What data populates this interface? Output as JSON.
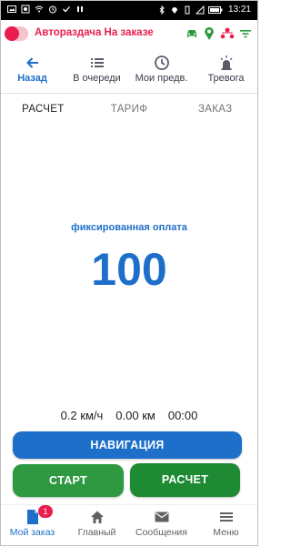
{
  "status_bar": {
    "time": "13:21"
  },
  "app": {
    "title": "Авторaздача На заказе",
    "accent": "#e91e4f"
  },
  "nav": {
    "items": [
      {
        "label": "Назад",
        "icon": "arrow-back-icon",
        "active": true
      },
      {
        "label": "В очереди",
        "icon": "list-icon"
      },
      {
        "label": "Мои предв.",
        "icon": "clock-icon"
      },
      {
        "label": "Тревога",
        "icon": "alarm-light-icon"
      }
    ]
  },
  "tabs": [
    {
      "label": "РАСЧЕТ",
      "active": true
    },
    {
      "label": "ТАРИФ"
    },
    {
      "label": "ЗАКАЗ"
    }
  ],
  "fare": {
    "label": "фиксированная оплата",
    "value": "100"
  },
  "stats": {
    "speed": "0.2 км/ч",
    "distance": "0.00 км",
    "time": "00:00"
  },
  "buttons": {
    "navigation": "НАВИГАЦИЯ",
    "start": "СТАРТ",
    "calculate": "РАСЧЕТ"
  },
  "bottom_nav": {
    "items": [
      {
        "label": "Мой заказ",
        "icon": "document-icon",
        "badge": "1",
        "active": true
      },
      {
        "label": "Главный",
        "icon": "home-icon"
      },
      {
        "label": "Сообщения",
        "icon": "mail-icon"
      },
      {
        "label": "Меню",
        "icon": "menu-icon"
      }
    ]
  },
  "colors": {
    "primary_blue": "#1e6fc9",
    "green": "#2e9940",
    "accent_pink": "#e91e4f"
  }
}
